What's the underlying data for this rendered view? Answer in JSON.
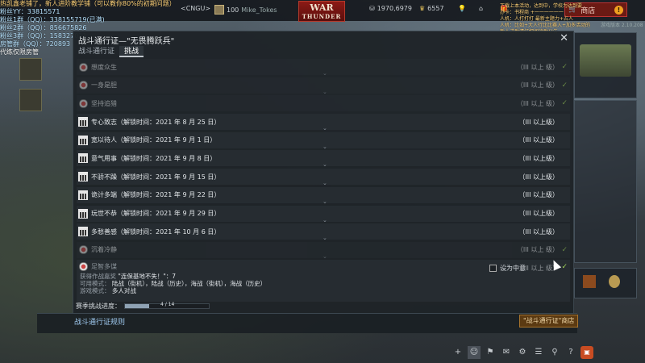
{
  "overlay": {
    "lines": [
      "热凯鑫老铺了，新人进阶教学铺（可以教你80%的初期问题）",
      "粉丝YY：33815571",
      "粉丝1群（QQ）：338155719(已满)",
      "粉丝2群（QQ）：856675826",
      "粉丝3群（QQ）：158327011",
      "房管群（QQ）：720893",
      "代练仅限房管"
    ],
    "right_lines": [
      "下载上本活动，达到中，学校为达到要",
      "办卡：书程商 +一一一一一一",
      "人机：人打打打 最新主题力+占人",
      "人机：比如+大人行比比赛入+加多活动的",
      "新人进群请仔细阅读群公告"
    ]
  },
  "topbar": {
    "squad": "<CNGU>",
    "level": "100",
    "player": "Mike_Tokes",
    "logo_top": "WAR",
    "logo_bottom": "THUNDER",
    "silver": "1970,6979",
    "gold": "6557",
    "shop_label": "商店",
    "shop_alert": "!",
    "version": "游戏版本 2.10.208"
  },
  "modal": {
    "title": "战斗通行证—\"无畏腾跃兵\"",
    "tabs": [
      "战斗通行证",
      "挑战"
    ],
    "active_tab": 1,
    "rows": [
      {
        "icon": "medal",
        "label": "想度众生",
        "req": "（III 以上 级）",
        "done": true,
        "dim": true,
        "chevron": true
      },
      {
        "icon": "medal",
        "label": "一身是胆",
        "req": "（III 以上 级）",
        "done": true,
        "dim": true,
        "chevron": true
      },
      {
        "icon": "medal",
        "label": "坚持追猎",
        "req": "（III 以上 级）",
        "done": true,
        "dim": true,
        "chevron": false
      },
      {
        "icon": "calendar",
        "label": "专心致志（解锁时间：2021 年 8 月 25 日）",
        "req": "（III 以上级）",
        "done": false,
        "dim": false,
        "chevron": true
      },
      {
        "icon": "calendar",
        "label": "宽以待人（解锁时间：2021 年 9 月 1 日）",
        "req": "（III 以上级）",
        "done": false,
        "dim": false,
        "chevron": true
      },
      {
        "icon": "calendar",
        "label": "意气用事（解锁时间：2021 年 9 月 8 日）",
        "req": "（III 以上级）",
        "done": false,
        "dim": false,
        "chevron": true
      },
      {
        "icon": "calendar",
        "label": "不骄不躁（解锁时间：2021 年 9 月 15 日）",
        "req": "（III 以上级）",
        "done": false,
        "dim": false,
        "chevron": true
      },
      {
        "icon": "calendar",
        "label": "诡计多端（解锁时间：2021 年 9 月 22 日）",
        "req": "（III 以上级）",
        "done": false,
        "dim": false,
        "chevron": true
      },
      {
        "icon": "calendar",
        "label": "玩世不恭（解锁时间：2021 年 9 月 29 日）",
        "req": "（III 以上级）",
        "done": false,
        "dim": false,
        "chevron": true
      },
      {
        "icon": "calendar",
        "label": "多愁善感（解锁时间：2021 年 10 月 6 日）",
        "req": "（III 以上级）",
        "done": false,
        "dim": false,
        "chevron": true
      },
      {
        "icon": "medal",
        "label": "沉着冷静",
        "req": "（III 以上 级）",
        "done": true,
        "dim": true,
        "chevron": true
      }
    ],
    "expanded": {
      "label": "足智多谋",
      "line1_key": "获得作战嘉奖",
      "line1_val": "\"连保基地不失！\"：7",
      "line2_key": "可用模式：",
      "line2_val": "陆战（街机），陆战（历史），海战（街机），海战（历史）",
      "line3_key": "游戏模式：",
      "line3_val": "多人对战",
      "favorite_label": "设为中意",
      "req": "（III 以上 级）"
    },
    "season_label": "赛季挑战进度：",
    "season_value": "4 / 14",
    "season_fraction": 0.29,
    "rules_link": "战斗通行证规则",
    "shop_link": "\"战斗通行证\"商店"
  },
  "colors": {
    "accent_green": "#9fd35a",
    "modal_bg": "#1e2328",
    "link_blue": "#9fc9ef",
    "shop_red": "#6b1a14"
  }
}
